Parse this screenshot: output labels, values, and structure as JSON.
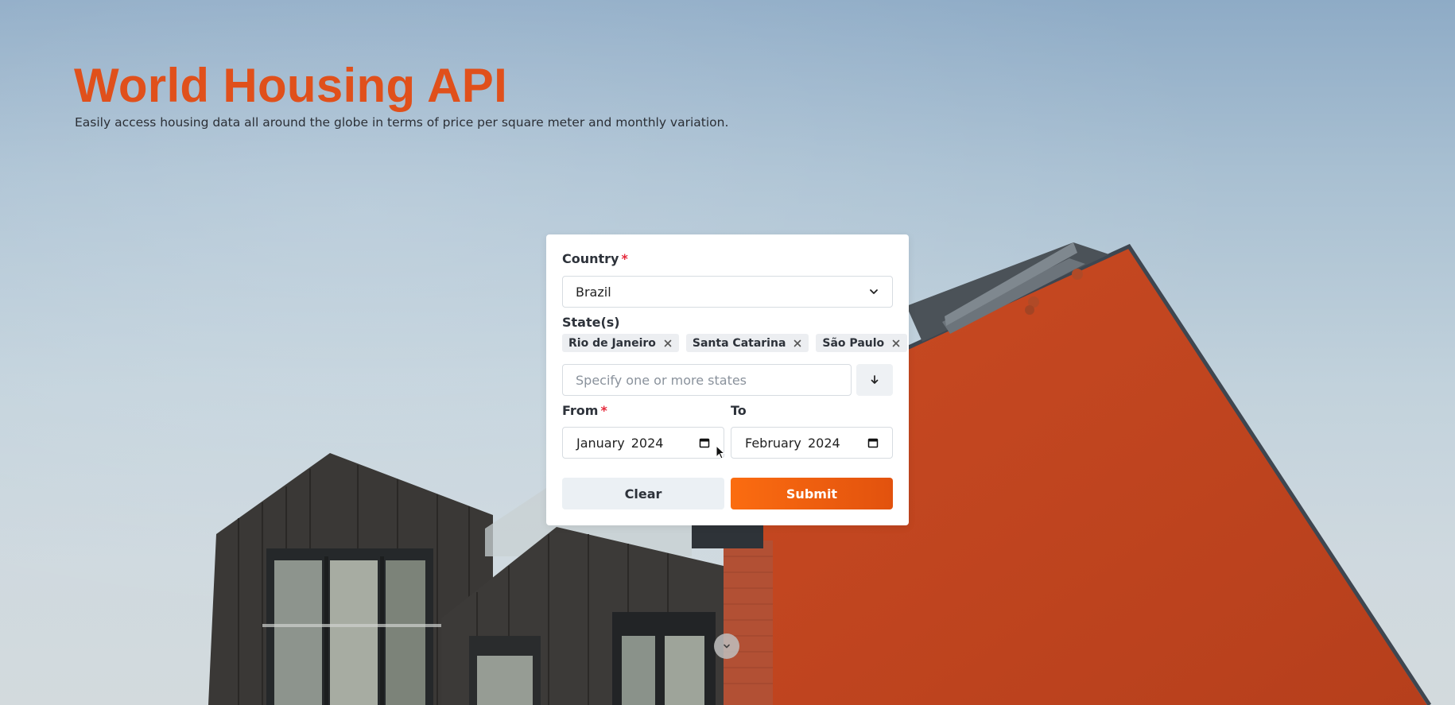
{
  "hero": {
    "title": "World Housing API",
    "subtitle": "Easily access housing data all around the globe in terms of price per square meter and monthly variation."
  },
  "form": {
    "country": {
      "label": "Country",
      "required_mark": "*",
      "selected": "Brazil",
      "icon": "chevron-down-icon"
    },
    "states": {
      "label": "State(s)",
      "selected": [
        "Rio de Janeiro",
        "Santa Catarina",
        "São Paulo"
      ],
      "placeholder": "Specify one or more states",
      "remove_icon": "close-icon",
      "dropdown_icon": "arrow-down-icon"
    },
    "from": {
      "label": "From",
      "required_mark": "*",
      "value": "January 2024",
      "icon": "calendar-icon"
    },
    "to": {
      "label": "To",
      "value": "February 2024",
      "icon": "calendar-icon"
    },
    "buttons": {
      "clear": "Clear",
      "submit": "Submit"
    }
  },
  "colors": {
    "accent": "#e0501b",
    "submit_gradient_start": "#fb6c10",
    "submit_gradient_end": "#e2520e",
    "required": "#e5293b"
  },
  "scroll_down_icon": "chevron-down-icon"
}
